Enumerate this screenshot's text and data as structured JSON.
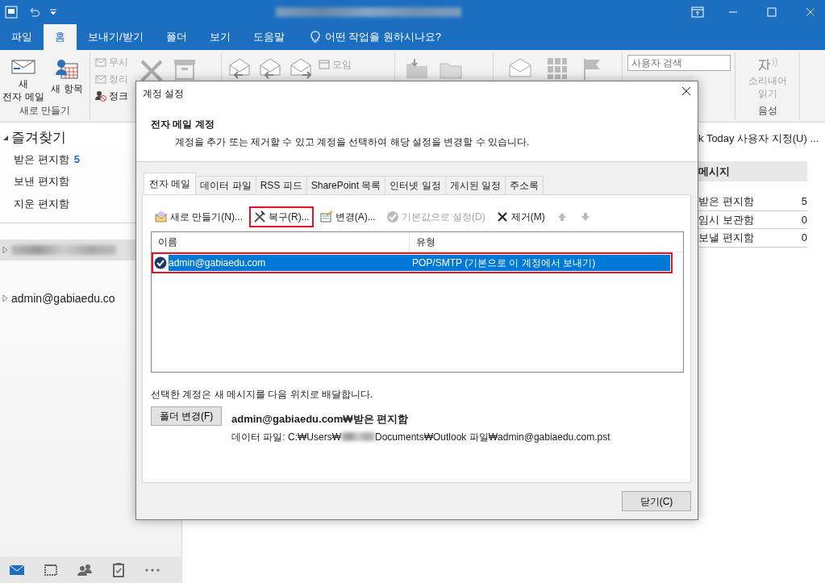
{
  "ribbon_tabs": [
    {
      "label": "파일",
      "selected": false
    },
    {
      "label": "홈",
      "selected": true
    },
    {
      "label": "보내기/받기",
      "selected": false
    },
    {
      "label": "폴더",
      "selected": false
    },
    {
      "label": "보기",
      "selected": false
    },
    {
      "label": "도움말",
      "selected": false
    }
  ],
  "tell_me": "어떤 작업을 원하시나요?",
  "ribbon": {
    "new_email": "새\n전자 메일",
    "new_items": "새 항목",
    "new_group_label": "새로 만들기",
    "small_buttons": [
      {
        "label": "무시",
        "disabled": true
      },
      {
        "label": "정리",
        "disabled": true
      },
      {
        "label": "정크",
        "disabled": false
      }
    ],
    "meeting": {
      "label": "모임",
      "disabled": true
    },
    "search_placeholder": "사용자 검색",
    "read_aloud": {
      "label": "소리내어\n읽기",
      "disabled": true
    },
    "voice_group_label": "음성"
  },
  "navigation": {
    "favorites": {
      "label": "즐겨찾기",
      "expanded": true,
      "items": [
        {
          "label": "받은 편지함",
          "count": "5"
        },
        {
          "label": "보낸 편지함"
        },
        {
          "label": "지운 편지함"
        }
      ]
    },
    "accounts": [
      {
        "redacted": true,
        "expanded": false,
        "selected": true
      },
      {
        "label": "admin@gabiaedu.co",
        "expanded": false,
        "selected": false
      }
    ]
  },
  "module_bar": [
    {
      "kind": "mail",
      "selected": true
    },
    {
      "kind": "calendar",
      "selected": false
    },
    {
      "kind": "people",
      "selected": false
    },
    {
      "kind": "tasks",
      "selected": false
    },
    {
      "kind": "more",
      "selected": false
    }
  ],
  "outlook_today": {
    "customize_link": "k Today 사용자 지정(U) ...",
    "messages": {
      "title": "메시지",
      "rows": [
        {
          "label": "받은 편지함",
          "count": "5"
        },
        {
          "label": "임시 보관함",
          "count": "0"
        },
        {
          "label": "보낼 편지함",
          "count": "0"
        }
      ]
    }
  },
  "dialog": {
    "title": "계정 설정",
    "heading": "전자 메일 계정",
    "description": "계정을 추가 또는 제거할 수 있고 계정을 선택하여 해당 설정을 변경할 수 있습니다.",
    "tabs": [
      {
        "label": "전자 메일",
        "selected": true
      },
      {
        "label": "데이터 파일",
        "selected": false
      },
      {
        "label": "RSS 피드",
        "selected": false
      },
      {
        "label": "SharePoint 목록",
        "selected": false
      },
      {
        "label": "인터넷 일정",
        "selected": false
      },
      {
        "label": "게시된 일정",
        "selected": false
      },
      {
        "label": "주소록",
        "selected": false
      }
    ],
    "toolbar": [
      {
        "kind": "new",
        "label": "새로 만들기(N)...",
        "disabled": false,
        "highlighted": false
      },
      {
        "kind": "repair",
        "label": "복구(R)...",
        "disabled": false,
        "highlighted": true
      },
      {
        "kind": "change",
        "label": "변경(A)...",
        "disabled": false,
        "highlighted": false
      },
      {
        "kind": "default",
        "label": "기본값으로 설정(D)",
        "disabled": true,
        "highlighted": false
      },
      {
        "kind": "remove",
        "label": "제거(M)",
        "disabled": false,
        "highlighted": false
      },
      {
        "kind": "up",
        "disabled": true,
        "highlighted": false
      },
      {
        "kind": "down",
        "disabled": true,
        "highlighted": false
      }
    ],
    "columns": [
      "이름",
      "유형"
    ],
    "rows": [
      {
        "name": "admin@gabiaedu.com",
        "type": "POP/SMTP (기본으로 이 계정에서 보내기)",
        "selected": true,
        "highlighted": true
      }
    ],
    "delivery_note": "선택한 계정은 새 메시지를 다음 위치로 배달합니다.",
    "change_folder_button": "폴더 변경(F)",
    "delivery_folder": "admin@gabiaedu.com₩받은 편지함",
    "data_file_prefix": "데이터 파일: C:₩Users₩",
    "data_file_suffix": "Documents₩Outlook 파일₩admin@gabiaedu.com.pst",
    "close_button": "닫기(C)"
  }
}
